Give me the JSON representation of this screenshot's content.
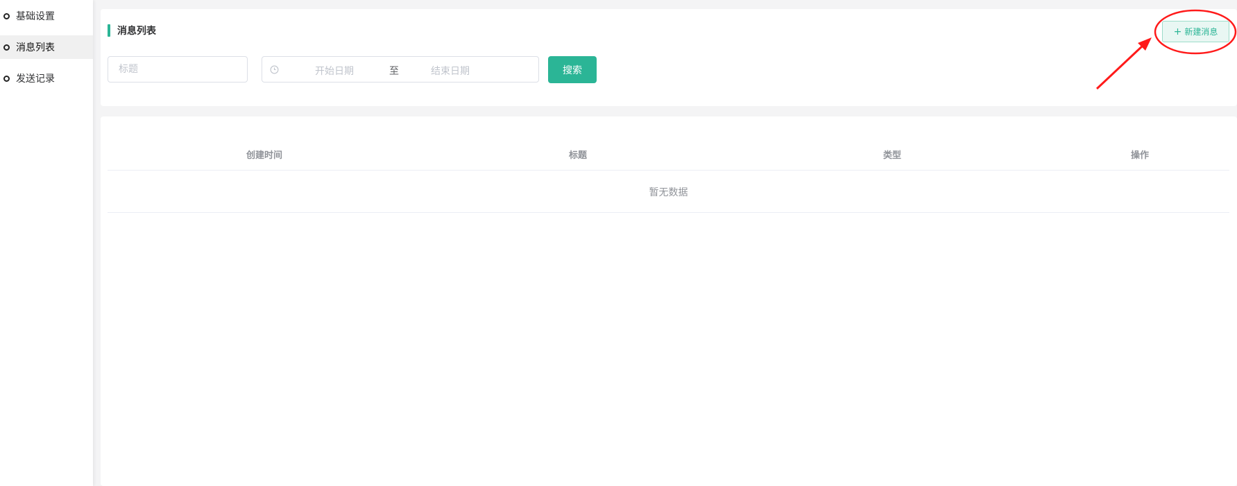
{
  "sidebar": {
    "items": [
      {
        "label": "基础设置"
      },
      {
        "label": "消息列表"
      },
      {
        "label": "发送记录"
      }
    ]
  },
  "header": {
    "title": "消息列表",
    "new_button_label": "新建消息"
  },
  "filters": {
    "title_placeholder": "标题",
    "start_date_placeholder": "开始日期",
    "range_separator": "至",
    "end_date_placeholder": "结束日期",
    "search_label": "搜索"
  },
  "table": {
    "columns": [
      "创建时间",
      "标题",
      "类型",
      "操作"
    ],
    "empty_text": "暂无数据"
  },
  "colors": {
    "accent": "#2bb596",
    "annotation": "#ff1a1a"
  },
  "icons": {
    "sidebar_item": "circle-icon",
    "date": "clock-icon",
    "new_button": "plus-icon"
  }
}
